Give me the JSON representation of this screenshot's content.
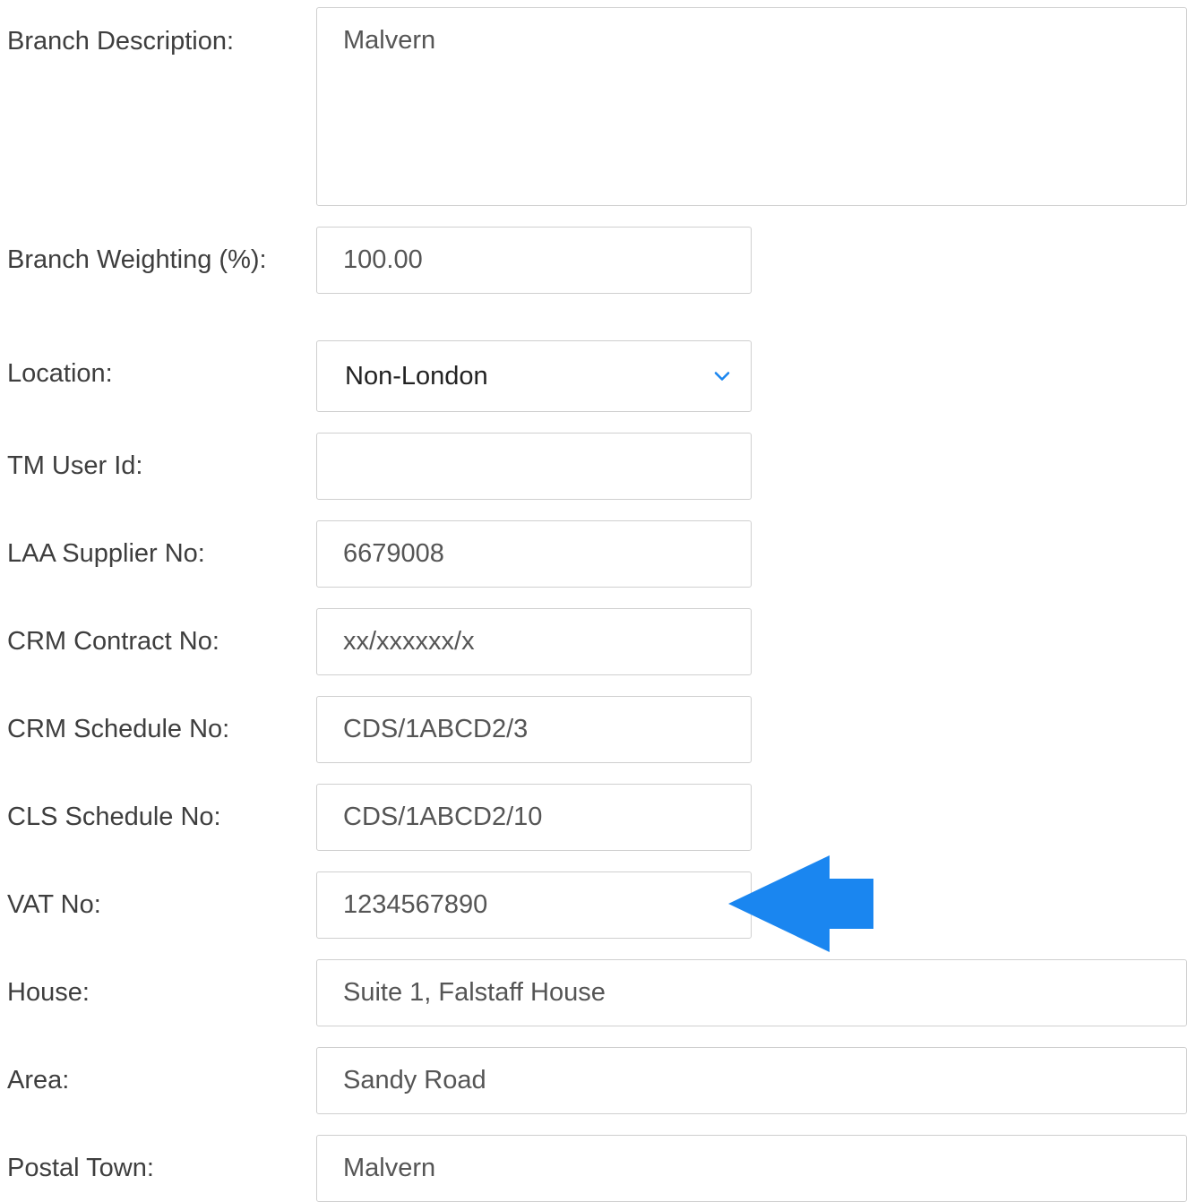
{
  "form": {
    "branch_description": {
      "label": "Branch Description:",
      "value": "Malvern"
    },
    "branch_weighting": {
      "label": "Branch Weighting (%):",
      "value": "100.00"
    },
    "location": {
      "label": "Location:",
      "value": "Non-London"
    },
    "tm_user_id": {
      "label": "TM User Id:",
      "value": ""
    },
    "laa_supplier_no": {
      "label": "LAA Supplier No:",
      "value": "6679008"
    },
    "crm_contract_no": {
      "label": "CRM Contract No:",
      "value": "xx/xxxxxx/x"
    },
    "crm_schedule_no": {
      "label": "CRM Schedule No:",
      "value": "CDS/1ABCD2/3"
    },
    "cls_schedule_no": {
      "label": "CLS Schedule No:",
      "value": "CDS/1ABCD2/10"
    },
    "vat_no": {
      "label": "VAT No:",
      "value": "1234567890"
    },
    "house": {
      "label": "House:",
      "value": "Suite 1, Falstaff House"
    },
    "area": {
      "label": "Area:",
      "value": "Sandy Road"
    },
    "postal_town": {
      "label": "Postal Town:",
      "value": "Malvern"
    }
  },
  "icons": {
    "location_dropdown": "chevron-down-icon",
    "vat_pointer": "arrow-left-icon"
  },
  "colors": {
    "accent_blue": "#1a86f0",
    "field_border": "#cfcfcf",
    "label_text": "#3e3e3e"
  }
}
